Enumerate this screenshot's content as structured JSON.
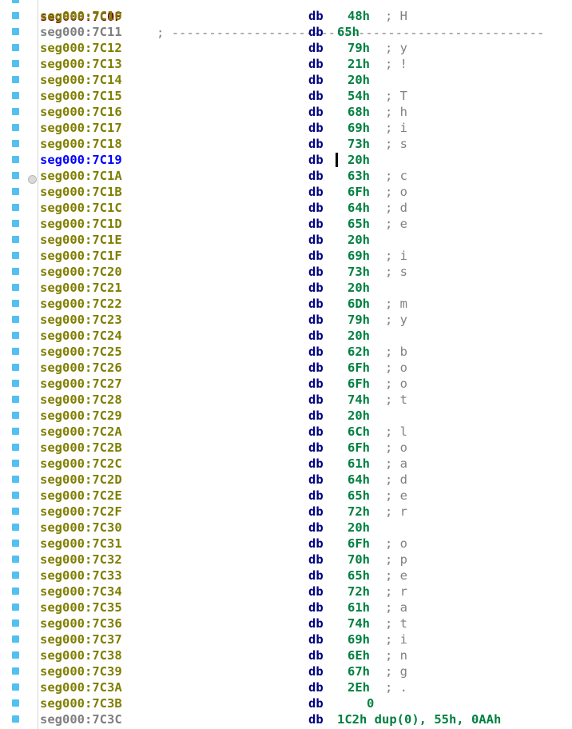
{
  "window": {
    "title": "IDA View"
  },
  "cursor_address": "seg000:7C19",
  "partial_top": {
    "address": "seg000:7C0F",
    "text": ";",
    "rule": "--------------------------------------------------"
  },
  "rows": [
    {
      "address": "seg000:7C10",
      "mnemonic": "db",
      "operand": "48h",
      "comment": "; H",
      "style": "olive"
    },
    {
      "address": "seg000:7C11",
      "mnemonic": "db",
      "operand": "65h",
      "comment": "",
      "style": "gray"
    },
    {
      "address": "seg000:7C12",
      "mnemonic": "db",
      "operand": "79h",
      "comment": "; y",
      "style": "olive"
    },
    {
      "address": "seg000:7C13",
      "mnemonic": "db",
      "operand": "21h",
      "comment": "; !",
      "style": "olive"
    },
    {
      "address": "seg000:7C14",
      "mnemonic": "db",
      "operand": "20h",
      "comment": "",
      "style": "olive"
    },
    {
      "address": "seg000:7C15",
      "mnemonic": "db",
      "operand": "54h",
      "comment": "; T",
      "style": "olive"
    },
    {
      "address": "seg000:7C16",
      "mnemonic": "db",
      "operand": "68h",
      "comment": "; h",
      "style": "olive"
    },
    {
      "address": "seg000:7C17",
      "mnemonic": "db",
      "operand": "69h",
      "comment": "; i",
      "style": "olive"
    },
    {
      "address": "seg000:7C18",
      "mnemonic": "db",
      "operand": "73h",
      "comment": "; s",
      "style": "olive"
    },
    {
      "address": "seg000:7C19",
      "mnemonic": "db",
      "operand": "20h",
      "comment": "",
      "style": "blue"
    },
    {
      "address": "seg000:7C1A",
      "mnemonic": "db",
      "operand": "63h",
      "comment": "; c",
      "style": "olive"
    },
    {
      "address": "seg000:7C1B",
      "mnemonic": "db",
      "operand": "6Fh",
      "comment": "; o",
      "style": "olive"
    },
    {
      "address": "seg000:7C1C",
      "mnemonic": "db",
      "operand": "64h",
      "comment": "; d",
      "style": "olive"
    },
    {
      "address": "seg000:7C1D",
      "mnemonic": "db",
      "operand": "65h",
      "comment": "; e",
      "style": "olive"
    },
    {
      "address": "seg000:7C1E",
      "mnemonic": "db",
      "operand": "20h",
      "comment": "",
      "style": "olive"
    },
    {
      "address": "seg000:7C1F",
      "mnemonic": "db",
      "operand": "69h",
      "comment": "; i",
      "style": "olive"
    },
    {
      "address": "seg000:7C20",
      "mnemonic": "db",
      "operand": "73h",
      "comment": "; s",
      "style": "olive"
    },
    {
      "address": "seg000:7C21",
      "mnemonic": "db",
      "operand": "20h",
      "comment": "",
      "style": "olive"
    },
    {
      "address": "seg000:7C22",
      "mnemonic": "db",
      "operand": "6Dh",
      "comment": "; m",
      "style": "olive"
    },
    {
      "address": "seg000:7C23",
      "mnemonic": "db",
      "operand": "79h",
      "comment": "; y",
      "style": "olive"
    },
    {
      "address": "seg000:7C24",
      "mnemonic": "db",
      "operand": "20h",
      "comment": "",
      "style": "olive"
    },
    {
      "address": "seg000:7C25",
      "mnemonic": "db",
      "operand": "62h",
      "comment": "; b",
      "style": "olive"
    },
    {
      "address": "seg000:7C26",
      "mnemonic": "db",
      "operand": "6Fh",
      "comment": "; o",
      "style": "olive"
    },
    {
      "address": "seg000:7C27",
      "mnemonic": "db",
      "operand": "6Fh",
      "comment": "; o",
      "style": "olive"
    },
    {
      "address": "seg000:7C28",
      "mnemonic": "db",
      "operand": "74h",
      "comment": "; t",
      "style": "olive"
    },
    {
      "address": "seg000:7C29",
      "mnemonic": "db",
      "operand": "20h",
      "comment": "",
      "style": "olive"
    },
    {
      "address": "seg000:7C2A",
      "mnemonic": "db",
      "operand": "6Ch",
      "comment": "; l",
      "style": "olive"
    },
    {
      "address": "seg000:7C2B",
      "mnemonic": "db",
      "operand": "6Fh",
      "comment": "; o",
      "style": "olive"
    },
    {
      "address": "seg000:7C2C",
      "mnemonic": "db",
      "operand": "61h",
      "comment": "; a",
      "style": "olive"
    },
    {
      "address": "seg000:7C2D",
      "mnemonic": "db",
      "operand": "64h",
      "comment": "; d",
      "style": "olive"
    },
    {
      "address": "seg000:7C2E",
      "mnemonic": "db",
      "operand": "65h",
      "comment": "; e",
      "style": "olive"
    },
    {
      "address": "seg000:7C2F",
      "mnemonic": "db",
      "operand": "72h",
      "comment": "; r",
      "style": "olive"
    },
    {
      "address": "seg000:7C30",
      "mnemonic": "db",
      "operand": "20h",
      "comment": "",
      "style": "olive"
    },
    {
      "address": "seg000:7C31",
      "mnemonic": "db",
      "operand": "6Fh",
      "comment": "; o",
      "style": "olive"
    },
    {
      "address": "seg000:7C32",
      "mnemonic": "db",
      "operand": "70h",
      "comment": "; p",
      "style": "olive"
    },
    {
      "address": "seg000:7C33",
      "mnemonic": "db",
      "operand": "65h",
      "comment": "; e",
      "style": "olive"
    },
    {
      "address": "seg000:7C34",
      "mnemonic": "db",
      "operand": "72h",
      "comment": "; r",
      "style": "olive"
    },
    {
      "address": "seg000:7C35",
      "mnemonic": "db",
      "operand": "61h",
      "comment": "; a",
      "style": "olive"
    },
    {
      "address": "seg000:7C36",
      "mnemonic": "db",
      "operand": "74h",
      "comment": "; t",
      "style": "olive"
    },
    {
      "address": "seg000:7C37",
      "mnemonic": "db",
      "operand": "69h",
      "comment": "; i",
      "style": "olive"
    },
    {
      "address": "seg000:7C38",
      "mnemonic": "db",
      "operand": "6Eh",
      "comment": "; n",
      "style": "olive"
    },
    {
      "address": "seg000:7C39",
      "mnemonic": "db",
      "operand": "67h",
      "comment": "; g",
      "style": "olive"
    },
    {
      "address": "seg000:7C3A",
      "mnemonic": "db",
      "operand": "2Eh",
      "comment": "; .",
      "style": "olive"
    },
    {
      "address": "seg000:7C3B",
      "mnemonic": "db",
      "operand": "0",
      "comment": "",
      "style": "olive"
    }
  ],
  "dup_row": {
    "address": "seg000:7C3C",
    "mnemonic": "db",
    "operand": "1C2h dup(0), 55h, 0AAh",
    "style": "gray"
  },
  "colors": {
    "address_olive": "#7f7f00",
    "address_gray": "#7f7f7f",
    "address_cursor": "#0000ff",
    "mnemonic": "#000080",
    "operand": "#008040",
    "comment": "#808080",
    "gutter_marker": "#52c0f0"
  }
}
